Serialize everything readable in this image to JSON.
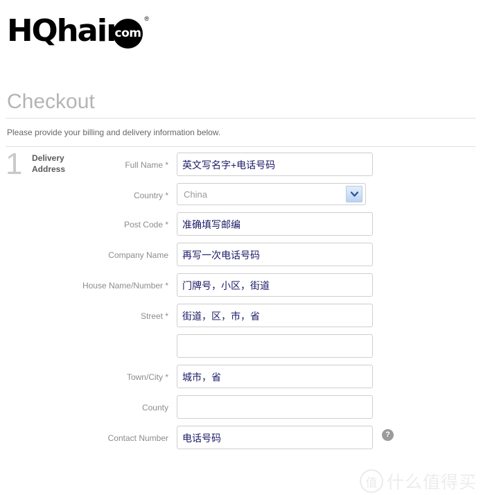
{
  "brand": {
    "word": "HQhair",
    "dot_text": "com",
    "registered_mark": "®"
  },
  "page": {
    "title": "Checkout",
    "intro": "Please provide your billing and delivery information below."
  },
  "step": {
    "number": "1",
    "title": "Delivery Address"
  },
  "colors": {
    "title_gray": "#b4b4b4",
    "label_gray": "#8c8c8c",
    "input_text_navy": "#1a1a66",
    "step_number_gray": "#c9c9c9",
    "select_arrow_blue": "#b9d2f2",
    "help_icon_gray": "#9b9b9b"
  },
  "form": {
    "fields": [
      {
        "label": "Full Name *",
        "type": "text",
        "value": "英文写名字+电话号码",
        "placeholder": "",
        "name": "full-name"
      },
      {
        "label": "Country *",
        "type": "select",
        "value": "China",
        "placeholder": "",
        "name": "country"
      },
      {
        "label": "Post Code *",
        "type": "text",
        "value": "准确填写邮编",
        "placeholder": "",
        "name": "post-code"
      },
      {
        "label": "Company Name",
        "type": "text",
        "value": "再写一次电话号码",
        "placeholder": "",
        "name": "company-name"
      },
      {
        "label": "House Name/Number *",
        "type": "text",
        "value": "门牌号，小区，街道",
        "placeholder": "",
        "name": "house-name-number"
      },
      {
        "label": "Street *",
        "type": "text",
        "value": "街道，区，市，省",
        "placeholder": "",
        "name": "street"
      },
      {
        "label": "",
        "type": "text",
        "value": "",
        "placeholder": "",
        "name": "street-line-2"
      },
      {
        "label": "Town/City *",
        "type": "text",
        "value": "城市，省",
        "placeholder": "",
        "name": "town-city"
      },
      {
        "label": "County",
        "type": "text",
        "value": "",
        "placeholder": "",
        "name": "county"
      },
      {
        "label": "Contact Number",
        "type": "text",
        "value": "电话号码",
        "placeholder": "",
        "name": "contact-number",
        "help": "?"
      }
    ]
  },
  "watermark": {
    "logo_glyph": "值",
    "text": "什么值得买"
  }
}
